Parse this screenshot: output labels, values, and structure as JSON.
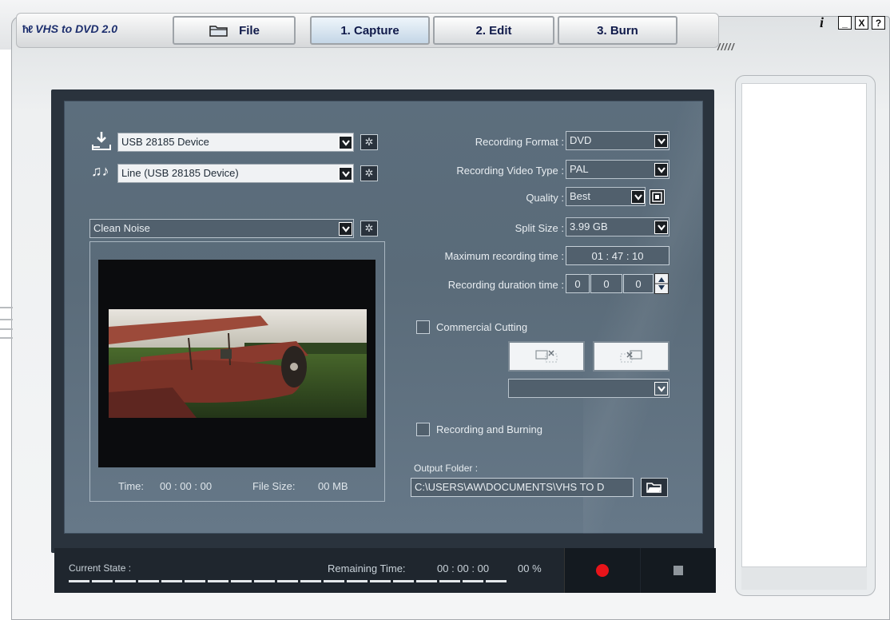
{
  "app": {
    "title": "VHS to DVD 2.0",
    "logo_mark": "ħℓ"
  },
  "tabs": {
    "file": "File",
    "capture": "1. Capture",
    "edit": "2. Edit",
    "burn": "3. Burn"
  },
  "window_controls": {
    "info": "i",
    "minimize": "_",
    "close": "X",
    "help": "?"
  },
  "devices": {
    "video": "USB 28185 Device",
    "audio": "Line (USB 28185 Device)",
    "filter": "Clean Noise"
  },
  "preview": {
    "time_label": "Time:",
    "time_value": "00 : 00 : 00",
    "size_label": "File Size:",
    "size_value": "00 MB"
  },
  "settings": {
    "format_label": "Recording Format :",
    "format_value": "DVD",
    "video_type_label": "Recording Video Type :",
    "video_type_value": "PAL",
    "quality_label": "Quality :",
    "quality_value": "Best",
    "split_label": "Split Size :",
    "split_value": "3.99 GB",
    "max_time_label": "Maximum recording time :",
    "max_time_value": "01 : 47 : 10",
    "duration_label": "Recording duration time :",
    "duration_h": "0",
    "duration_m": "0",
    "duration_s": "0"
  },
  "commercial": {
    "label": "Commercial Cutting"
  },
  "burning": {
    "label": "Recording and Burning"
  },
  "output": {
    "label": "Output Folder :",
    "path": "C:\\USERS\\AW\\DOCUMENTS\\VHS TO D"
  },
  "status": {
    "state_label": "Current State :",
    "remaining_label": "Remaining Time:",
    "remaining_value": "00 : 00 : 00",
    "percent": "00 %"
  },
  "colors": {
    "record": "#e8141a",
    "panel": "#5c6e7d",
    "frame": "#2a333d"
  }
}
